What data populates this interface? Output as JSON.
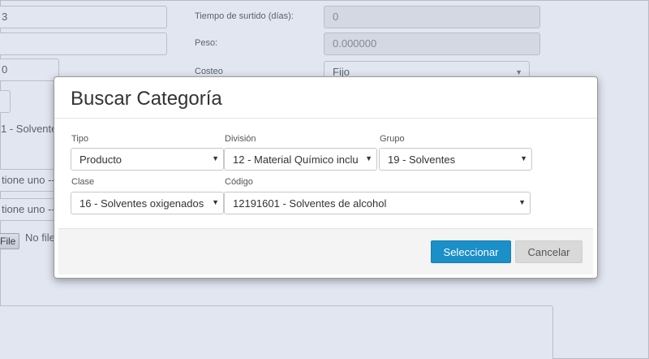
{
  "background": {
    "field1_value": "3",
    "field3_value": "0",
    "category_value": "1 - Solvente",
    "select1_value": "tione uno --",
    "select2_value": "tione uno --",
    "file_button": "File",
    "file_status": "No file",
    "lead_time_label": "Tiempo de surtido (días):",
    "lead_time_value": "0",
    "weight_label": "Peso:",
    "weight_value": "0.000000",
    "costing_label": "Costeo",
    "costing_value": "Fijo"
  },
  "modal": {
    "title": "Buscar Categoría",
    "tipo_label": "Tipo",
    "tipo_value": "Producto",
    "division_label": "División",
    "division_value": "12 - Material Químico inclu",
    "grupo_label": "Grupo",
    "grupo_value": "19 - Solventes",
    "clase_label": "Clase",
    "clase_value": "16 - Solventes oxigenados",
    "codigo_label": "Código",
    "codigo_value": "12191601 - Solventes de alcohol",
    "select_button": "Seleccionar",
    "cancel_button": "Cancelar"
  },
  "colors": {
    "primary": "#1a8fc8",
    "overlay": "#788cbe"
  }
}
